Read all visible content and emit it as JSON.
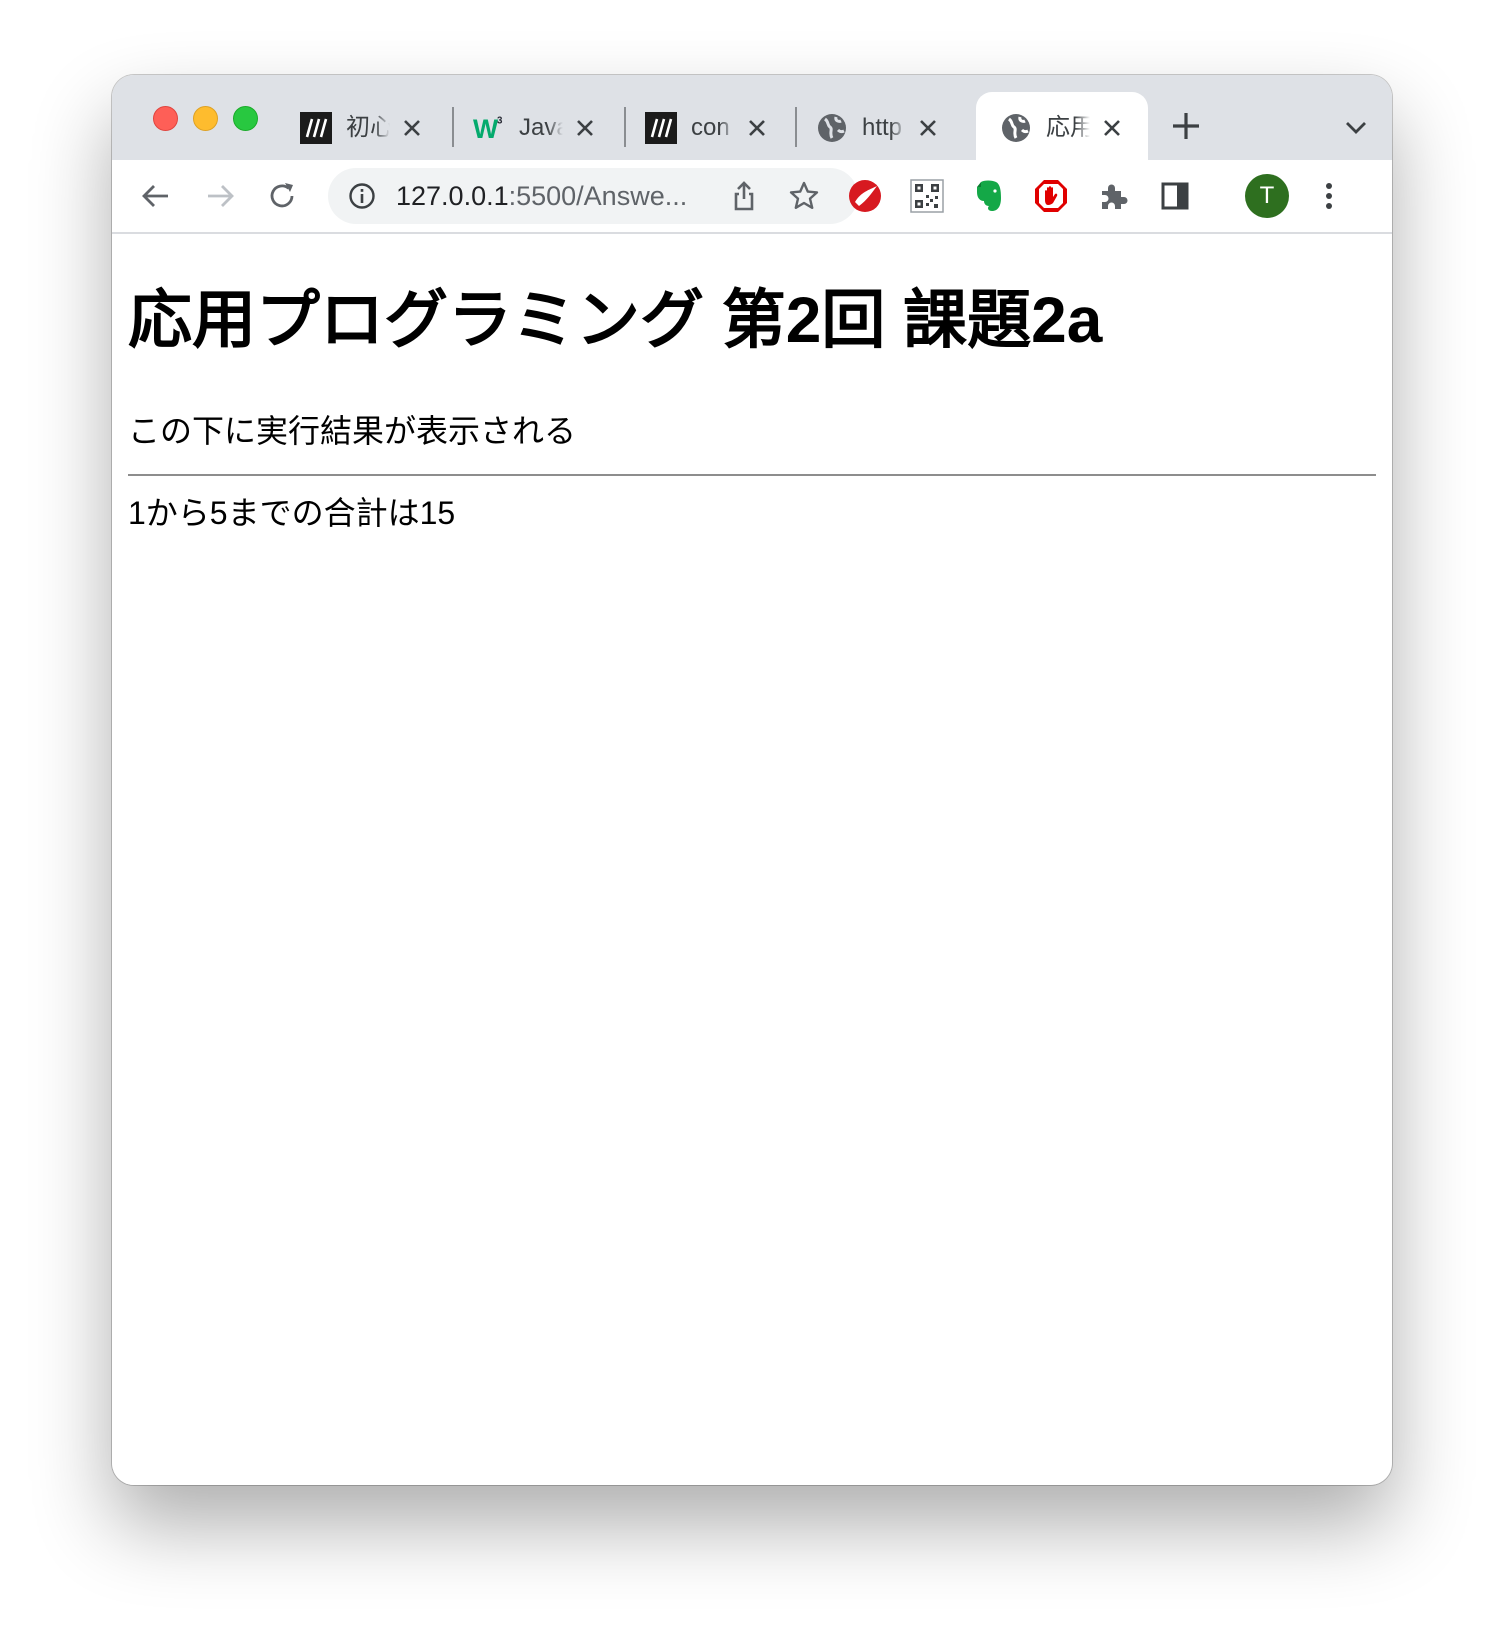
{
  "browser": {
    "tabs": [
      {
        "title": "初心",
        "favicon": "mdn-icon",
        "active": false
      },
      {
        "title": "Java",
        "favicon": "w3schools-icon",
        "active": false
      },
      {
        "title": "con",
        "favicon": "mdn-icon",
        "active": false
      },
      {
        "title": "http",
        "favicon": "globe-icon",
        "active": false
      },
      {
        "title": "応用",
        "favicon": "globe-icon",
        "active": true
      }
    ],
    "address_bar": {
      "url_host": "127.0.0.1",
      "url_path": ":5500/Answe..."
    },
    "profile_initial": "T",
    "extensions": [
      "trend-micro-icon",
      "qr-code-icon",
      "evernote-icon",
      "adblock-icon",
      "puzzle-extensions-icon",
      "side-panel-icon"
    ]
  },
  "page": {
    "heading": "応用プログラミング 第2回 課題2a",
    "description": "この下に実行結果が表示される",
    "result": "1から5までの合計は15"
  },
  "colors": {
    "tabstrip": "#dee1e6",
    "omnibox": "#f1f3f4",
    "avatar": "#2e6f1f"
  }
}
